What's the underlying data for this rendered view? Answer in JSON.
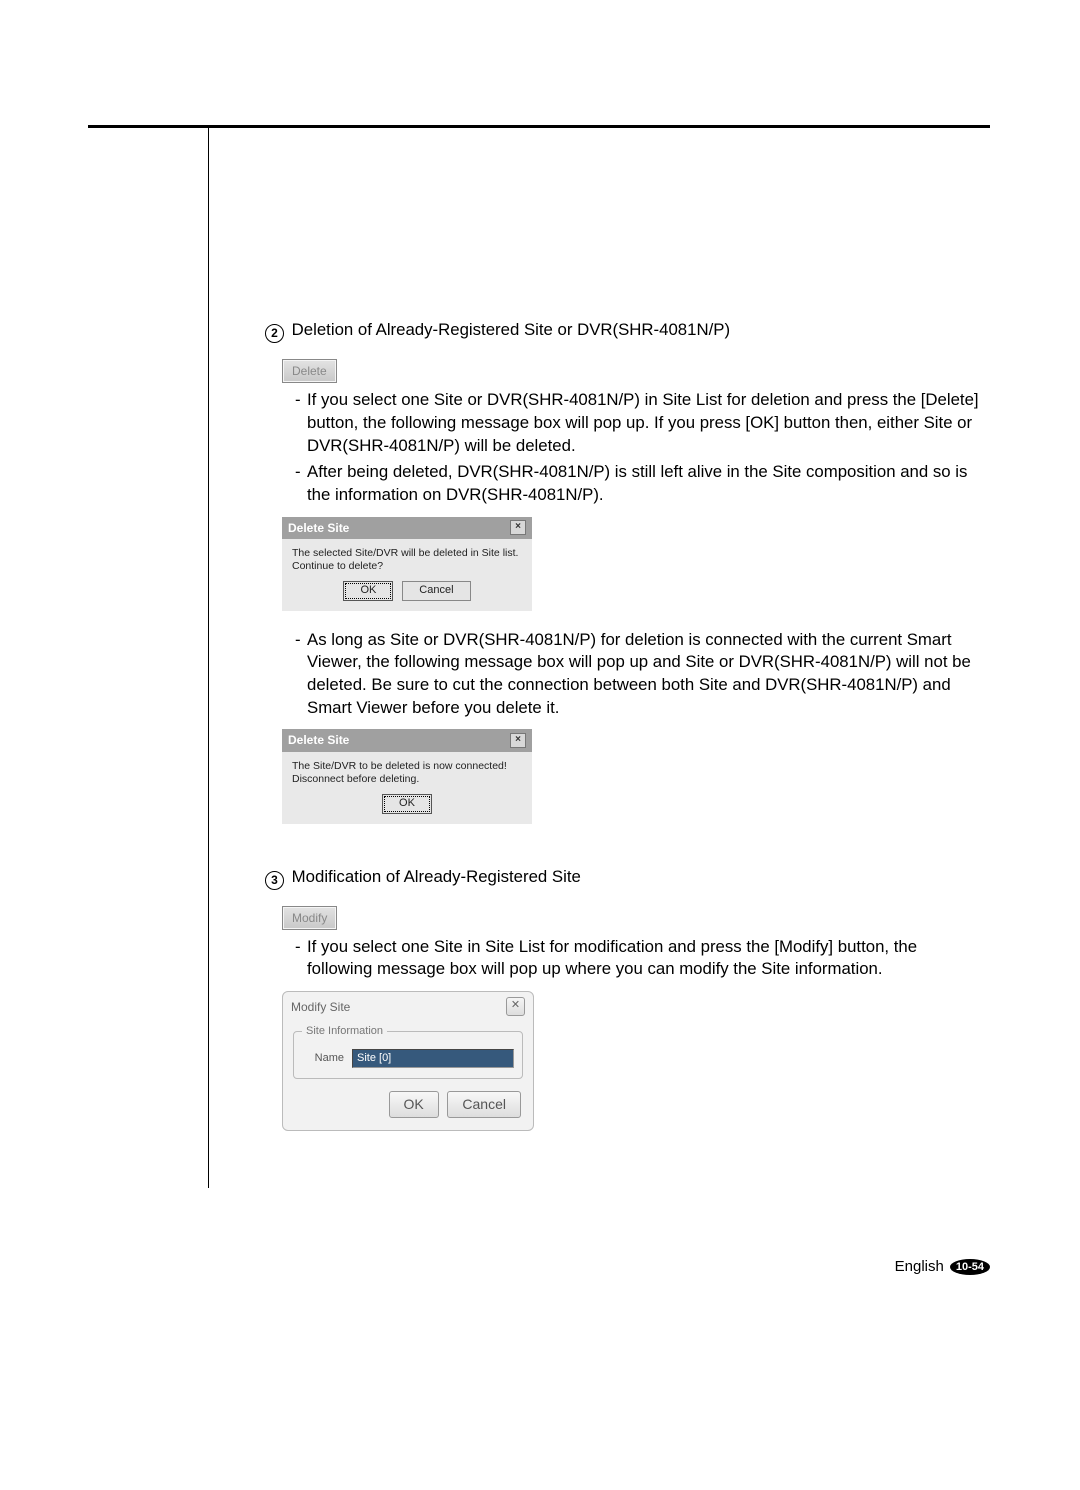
{
  "section2": {
    "num": "2",
    "title": "Deletion of Already-Registered Site or DVR(SHR-4081N/P)",
    "button_label": "Delete",
    "bullets": [
      "If you select one Site or DVR(SHR-4081N/P) in Site List for deletion and press the [Delete] button, the following message box will pop up. If you press [OK] button then, either Site or DVR(SHR-4081N/P) will be deleted.",
      "After being deleted, DVR(SHR-4081N/P) is still left alive in the Site composition  and so is the information on DVR(SHR-4081N/P)."
    ],
    "dialog1": {
      "title": "Delete Site",
      "message": "The selected Site/DVR will be deleted in Site list. Continue to delete?",
      "ok": "OK",
      "cancel": "Cancel"
    },
    "bullets2": [
      "As long as Site or DVR(SHR-4081N/P) for deletion is connected with the current Smart Viewer, the following message box will pop up and Site or DVR(SHR-4081N/P) will not be deleted. Be sure to cut the connection between both Site and DVR(SHR-4081N/P) and Smart Viewer before you delete it."
    ],
    "dialog2": {
      "title": "Delete Site",
      "message": "The Site/DVR to be deleted is now connected! Disconnect before deleting.",
      "ok": "OK"
    }
  },
  "section3": {
    "num": "3",
    "title": "Modification of Already-Registered Site",
    "button_label": "Modify",
    "bullets": [
      "If you select one Site in Site List for modification and press the [Modify] button, the following message box will pop up where you can modify the Site information."
    ],
    "dialog": {
      "title": "Modify Site",
      "fieldset_legend": "Site Information",
      "name_label": "Name",
      "name_value": "Site [0]",
      "ok": "OK",
      "cancel": "Cancel"
    }
  },
  "footer": {
    "lang": "English",
    "page": "10-54"
  }
}
